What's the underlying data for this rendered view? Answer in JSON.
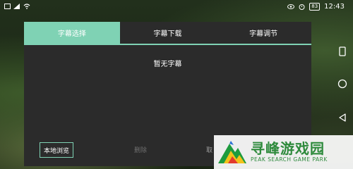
{
  "status_bar": {
    "time": "12:43",
    "battery": "83",
    "icons": [
      "notification-icon",
      "signal-icon",
      "wifi-icon",
      "eye-icon",
      "alarm-icon"
    ]
  },
  "tabs": [
    {
      "label": "字幕选择",
      "active": true
    },
    {
      "label": "字幕下载",
      "active": false
    },
    {
      "label": "字幕调节",
      "active": false
    }
  ],
  "content": {
    "empty_message": "暂无字幕"
  },
  "buttons": {
    "browse_label": "本地浏览",
    "delete_label": "删除",
    "cancel_label": "取"
  },
  "watermark": {
    "title": "寻峰游戏园",
    "subtitle": "PEAK SEARCH GAME PARK"
  },
  "colors": {
    "accent": "#7fd2b4",
    "panel": "#2b2b2b",
    "watermark_green": "#2e8a3c"
  }
}
